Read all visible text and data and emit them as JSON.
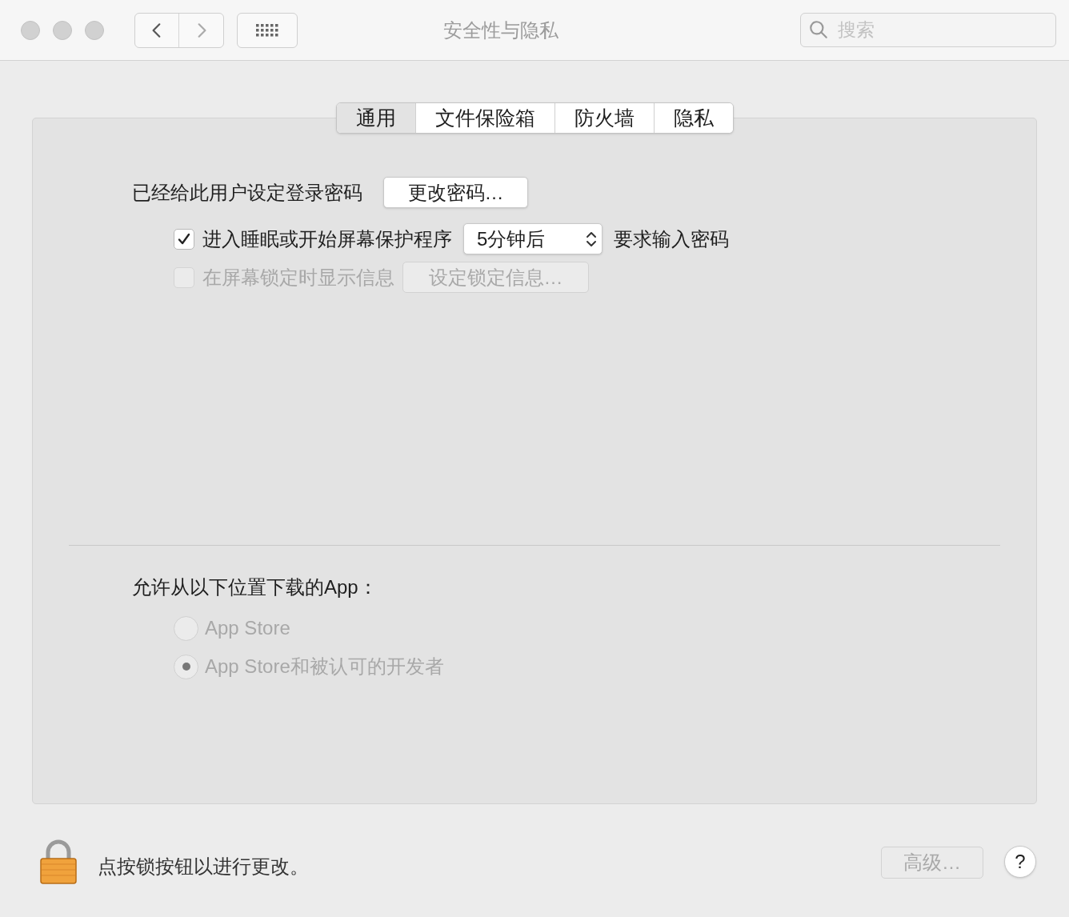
{
  "window": {
    "title": "安全性与隐私"
  },
  "toolbar": {
    "search": {
      "placeholder": "搜索"
    }
  },
  "tabs": [
    {
      "label": "通用",
      "selected": true
    },
    {
      "label": "文件保险箱",
      "selected": false
    },
    {
      "label": "防火墙",
      "selected": false
    },
    {
      "label": "隐私",
      "selected": false
    }
  ],
  "general": {
    "password_label": "已经给此用户设定登录密码",
    "change_password_button": "更改密码…",
    "require_password": {
      "checked": true,
      "disabled": false,
      "label": "进入睡眠或开始屏幕保护程序",
      "delay": "5分钟后",
      "suffix": "要求输入密码"
    },
    "lock_message": {
      "checked": false,
      "disabled": true,
      "label": "在屏幕锁定时显示信息",
      "button": "设定锁定信息…"
    }
  },
  "downloads": {
    "label": "允许从以下位置下载的App：",
    "options": [
      {
        "label": "App Store",
        "selected": false,
        "disabled": true
      },
      {
        "label": "App Store和被认可的开发者",
        "selected": true,
        "disabled": true
      }
    ]
  },
  "footer": {
    "lock_text": "点按锁按钮以进行更改。",
    "advanced_button": "高级…",
    "advanced_disabled": true,
    "help_button": "?"
  }
}
